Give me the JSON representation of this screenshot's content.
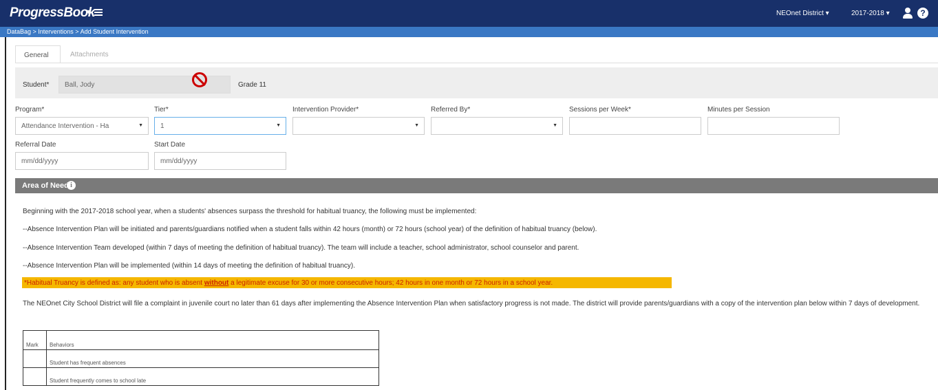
{
  "app": {
    "name": "ProgressBook",
    "district_menu": "NEOnet District",
    "year_menu": "2017-2018"
  },
  "header_icons": {
    "menu": "hamburger-icon",
    "user": "user-icon",
    "help": "help-icon"
  },
  "breadcrumb": {
    "text": "DataBag > Interventions > Add Student Intervention"
  },
  "tabs": [
    {
      "label": "General",
      "active": true
    },
    {
      "label": "Attachments",
      "active": false
    }
  ],
  "student": {
    "label": "Student*",
    "value": "Ball, Jody",
    "status_icon": "no-entry-icon",
    "grade_label": "Grade",
    "grade_value": "11"
  },
  "form": {
    "program": {
      "label": "Program*",
      "value": "Attendance Intervention - Ha"
    },
    "tier": {
      "label": "Tier*",
      "value": "1"
    },
    "provider": {
      "label": "Intervention Provider*",
      "value": ""
    },
    "referred_by": {
      "label": "Referred By*",
      "value": ""
    },
    "sessions_per_week": {
      "label": "Sessions per Week*",
      "value": ""
    },
    "minutes_per_session": {
      "label": "Minutes per Session",
      "value": ""
    },
    "referral_date": {
      "label": "Referral Date",
      "placeholder": "mm/dd/yyyy"
    },
    "start_date": {
      "label": "Start Date",
      "placeholder": "mm/dd/yyyy"
    }
  },
  "area_of_need": {
    "title": "Area of Need",
    "intro": "Beginning with the 2017-2018 school year, when a students' absences surpass the threshold for habitual truancy, the following must be implemented:",
    "points": [
      "--Absence Intervention Plan will be initiated and parents/guardians notified when a student falls within 42 hours (month) or 72 hours (school year) of the definition of habitual truancy (below).",
      "--Absence Intervention Team developed (within 7 days of meeting the definition of habitual truancy). The team will include a teacher, school administrator, school counselor and parent.",
      "--Absence Intervention Plan will be implemented (within 14 days of meeting the definition of habitual truancy)."
    ],
    "highlight": {
      "before": "*Habitual Truancy is defined as: any student who is absent ",
      "underlined": "without",
      "after": " a legitimate excuse for 30 or more consecutive hours; 42 hours in one month or 72 hours in a school year."
    },
    "closing": "The NEOnet City School District will file a complaint in juvenile court no later than 61 days after implementing the Absence Intervention Plan when satisfactory progress is not made. The district will provide parents/guardians with a copy of the intervention plan below within 7 days of development.",
    "table": {
      "headers": [
        "Mark",
        "Behaviors"
      ],
      "rows": [
        {
          "mark": "",
          "behavior": "Student has frequent absences"
        },
        {
          "mark": "",
          "behavior": "Student frequently comes to school late"
        }
      ]
    }
  }
}
